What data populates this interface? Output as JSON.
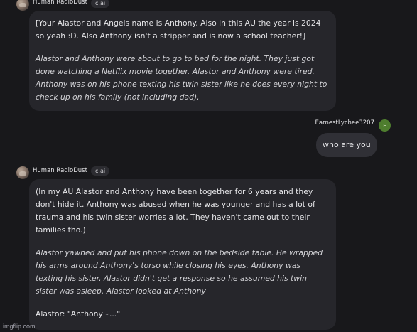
{
  "messages": [
    {
      "sender": "Human RadioDust",
      "badge": "c.ai",
      "paragraphs": [
        "[Your Alastor and Angels name is Anthony. Also in this AU the year is 2024 so yeah :D. Also Anthony isn't a stripper and is now a school teacher!]",
        "Alastor and Anthony were about to go to bed for the night. They just got done watching a Netflix movie together. Alastor and Anthony were tired. Anthony was on his phone texting his twin sister like he does every night to check up on his family (not including dad)."
      ]
    },
    {
      "sender": "EarnestLychee3207",
      "avatar_letter": "E",
      "text": "who are you"
    },
    {
      "sender": "Human RadioDust",
      "badge": "c.ai",
      "paragraphs": [
        "(In my AU Alastor and Anthony have been together for 6 years and they don't hide it. Anthony was abused when he was younger and has a lot of trauma and his twin sister worries a lot. They haven't came out to their families tho.)",
        "Alastor yawned and put his phone down on the bedside table. He wrapped his arms around Anthony's torso while closing his eyes. Anthony was texting his sister. Alastor didn't get a response so he assumed his twin sister was asleep. Alastor looked at Anthony",
        "Alastor: \"Anthony~...\""
      ]
    }
  ],
  "watermark": "imgflip.com",
  "colors": {
    "background": "#18181b",
    "bot_bubble": "#26262b",
    "user_bubble": "#303036",
    "user_avatar": "#4e7d2e"
  }
}
